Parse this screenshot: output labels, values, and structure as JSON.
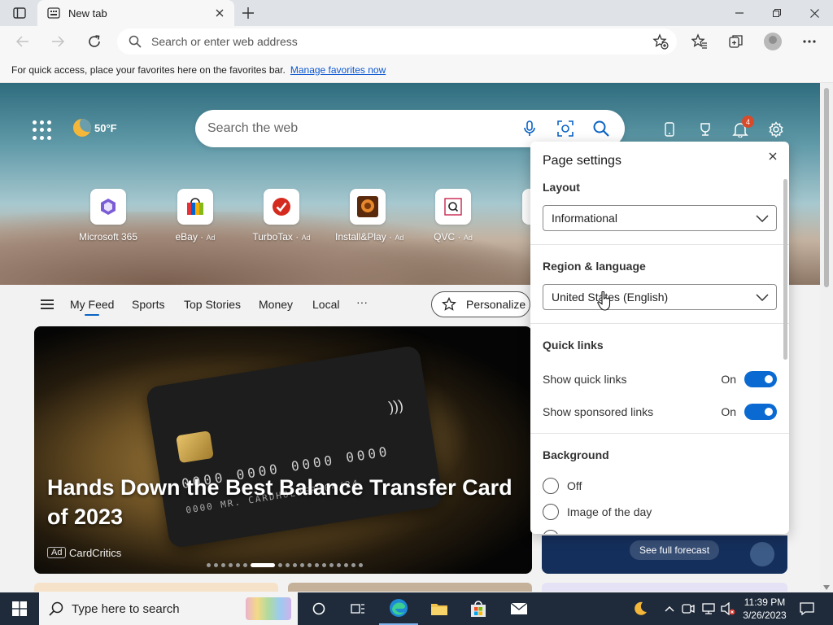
{
  "browser": {
    "tab_title": "New tab",
    "address_placeholder": "Search or enter web address",
    "favorites_message": "For quick access, place your favorites here on the favorites bar.",
    "favorites_link": "Manage favorites now"
  },
  "newtab": {
    "weather_temp": "50°F",
    "search_placeholder": "Search the web",
    "notification_count": "4",
    "quick_links": [
      {
        "name": "Microsoft 365",
        "ad": ""
      },
      {
        "name": "eBay",
        "ad": "Ad"
      },
      {
        "name": "TurboTax",
        "ad": "Ad"
      },
      {
        "name": "Install&Play",
        "ad": "Ad"
      },
      {
        "name": "QVC",
        "ad": "Ad"
      }
    ],
    "feed_tabs": [
      "My Feed",
      "Sports",
      "Top Stories",
      "Money",
      "Local",
      "···"
    ],
    "personalize_label": "Personalize",
    "hero": {
      "card_numbers": "0000 0000 0000 0000",
      "card_sub": "0000",
      "card_holder": "MR. CARDHOLDER",
      "card_expiry": "04/24",
      "headline": "Hands Down the Best Balance Transfer Card of 2023",
      "ad_label": "Ad",
      "source": "CardCritics",
      "carousel_index": 6,
      "carousel_total": 19
    },
    "full_forecast": "See full forecast"
  },
  "settings": {
    "title": "Page settings",
    "layout_heading": "Layout",
    "layout_value": "Informational",
    "region_heading": "Region & language",
    "region_value": "United States (English)",
    "quicklinks_heading": "Quick links",
    "show_quick_links": "Show quick links",
    "show_quick_links_state": "On",
    "show_sponsored_links": "Show sponsored links",
    "show_sponsored_links_state": "On",
    "background_heading": "Background",
    "background_options": [
      "Off",
      "Image of the day"
    ]
  },
  "taskbar": {
    "search_placeholder": "Type here to search",
    "time": "11:39 PM",
    "date": "3/26/2023"
  },
  "colors": {
    "accent": "#0a6ad2",
    "notification_badge": "#d74a2a",
    "taskbar": "#1f2b3b"
  }
}
